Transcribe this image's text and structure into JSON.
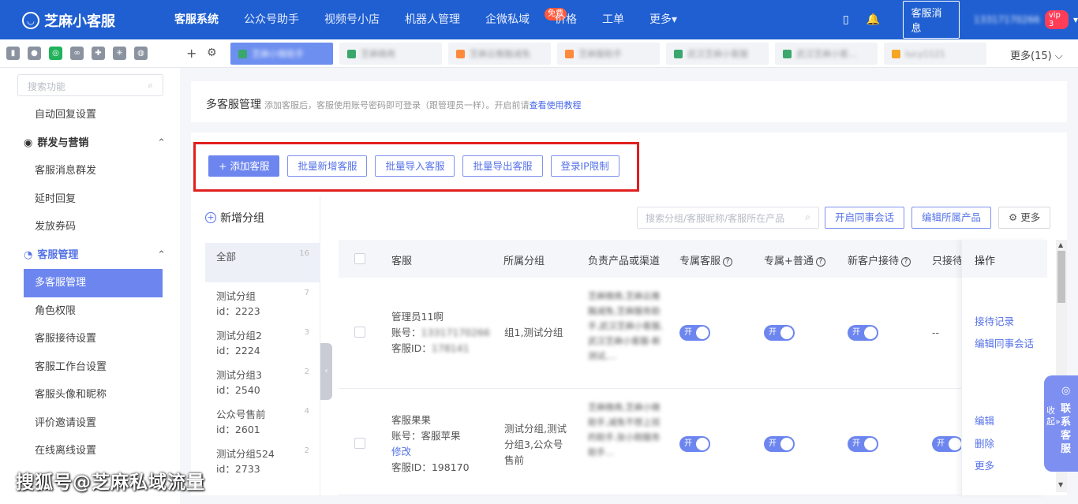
{
  "brand": {
    "name": "芝麻小客服",
    "logo_glyph": "◡"
  },
  "nav": {
    "items": [
      {
        "label": "客服系统"
      },
      {
        "label": "公众号助手"
      },
      {
        "label": "视频号小店"
      },
      {
        "label": "机器人管理"
      },
      {
        "label": "企微私域"
      },
      {
        "label": "价格"
      },
      {
        "label": "工单"
      },
      {
        "label": "更多▾"
      }
    ],
    "free_badge": "免费"
  },
  "topright": {
    "phone_icon": "▯",
    "bell_icon": "🔔",
    "msg_button": "客服消息",
    "user": "13317170266",
    "vip": "vip 3",
    "caret": "▾"
  },
  "tabbar": {
    "side_icons": [
      "page-icon",
      "chat-icon",
      "wechat-icon",
      "link-icon",
      "puzzle-icon",
      "star-icon",
      "globe-icon"
    ],
    "tabs": [
      {
        "label": "芝麻小微助手"
      },
      {
        "label": "芝麻微商"
      },
      {
        "label": "芝麻云推融减免"
      },
      {
        "label": "芝麻服助手"
      },
      {
        "label": "武汉芝麻小客服"
      },
      {
        "label": "武汉芝麻小客..."
      },
      {
        "label": "lucy1121"
      }
    ],
    "more": "更多(15) ⌵"
  },
  "sidebar": {
    "search_placeholder": "搜索功能",
    "items": [
      {
        "label": "自动回复设置"
      },
      {
        "label": "群发与营销"
      },
      {
        "label": "客服消息群发"
      },
      {
        "label": "延时回复"
      },
      {
        "label": "发放券码"
      },
      {
        "label": "客服管理"
      },
      {
        "label": "多客服管理"
      },
      {
        "label": "角色权限"
      },
      {
        "label": "客服接待设置"
      },
      {
        "label": "客服工作台设置"
      },
      {
        "label": "客服头像和昵称"
      },
      {
        "label": "评价邀请设置"
      },
      {
        "label": "在线离线设置"
      }
    ]
  },
  "watermark": "搜狐号@芝麻私域流量",
  "header": {
    "title": "多客服管理",
    "desc": "添加客服后，客服使用账号密码即可登录（跟管理员一样）。开启前请",
    "link": "查看使用教程"
  },
  "actions": {
    "add": "+ 添加客服",
    "batch_add": "批量新增客服",
    "batch_import": "批量导入客服",
    "batch_export": "批量导出客服",
    "ip_limit": "登录IP限制"
  },
  "groups": {
    "add_label": "新增分组",
    "items": [
      {
        "name": "全部",
        "id": "",
        "count": "16"
      },
      {
        "name": "测试分组",
        "id": "id：2223",
        "count": "7"
      },
      {
        "name": "测试分组2",
        "id": "id：2224",
        "count": "3"
      },
      {
        "name": "测试分组3",
        "id": "id：2540",
        "count": "2"
      },
      {
        "name": "公众号售前",
        "id": "id：2601",
        "count": "4"
      },
      {
        "name": "测试分组524",
        "id": "id：2733",
        "count": "2"
      }
    ]
  },
  "toolbar": {
    "search_placeholder": "搜索分组/客服昵称/客服所在产品",
    "enable_colleague": "开启同事会话",
    "edit_product": "编辑所属产品",
    "more": "更多"
  },
  "table": {
    "columns": [
      "客服",
      "所属分组",
      "负责产品或渠道",
      "专属客服",
      "专属+普通",
      "新客户接待",
      "只接待",
      "操作"
    ],
    "rows": [
      {
        "name": "管理员11啊",
        "account_label": "账号：",
        "account": "13317170266",
        "id_label": "客服ID：",
        "id": "178141",
        "group": "组1,测试分组",
        "products": "芝麻微商,芝麻云推融减免,芝麻服务助手,武汉芝麻小客服,武汉芝麻小客服-新测试,...",
        "toggle_on": "开",
        "only": "--",
        "ops": [
          "接待记录",
          "编辑同事会话"
        ]
      },
      {
        "name": "客服果果",
        "account_label": "账号：",
        "account": "客服苹果",
        "edit": "修改",
        "id_label": "客服ID：",
        "id": "198170",
        "group": "测试分组,测试分组3,公众号售前",
        "products": "芝麻微商,芝麻小微助手,减免不想上班的助手,张小刚服务助手...",
        "toggle_on": "开",
        "only": "",
        "ops": [
          "编辑",
          "删除",
          "更多"
        ]
      }
    ]
  },
  "float_btn": {
    "collapse": "收起»",
    "contact": "联系客服"
  }
}
